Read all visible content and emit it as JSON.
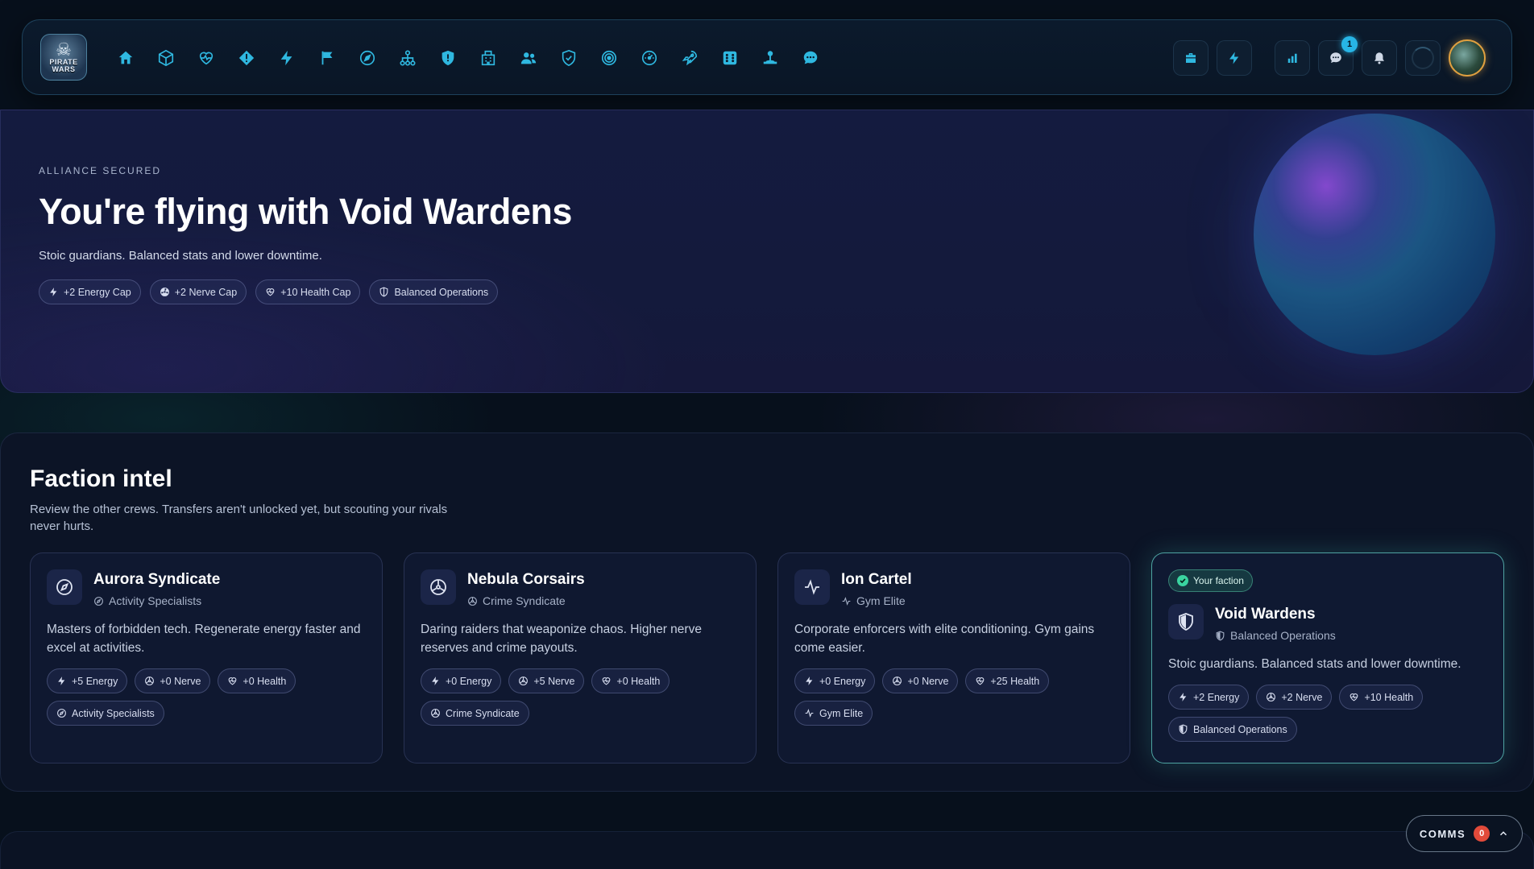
{
  "nav": {
    "logo_text": "PIRATE WARS",
    "items": [
      {
        "name": "home",
        "icon": "home-icon"
      },
      {
        "name": "inventory",
        "icon": "cube-icon"
      },
      {
        "name": "hospital",
        "icon": "heart-pulse-icon"
      },
      {
        "name": "crimes",
        "icon": "warning-diamond-icon"
      },
      {
        "name": "energy",
        "icon": "lightning-icon"
      },
      {
        "name": "missions",
        "icon": "flag-icon"
      },
      {
        "name": "explore",
        "icon": "compass-icon"
      },
      {
        "name": "network",
        "icon": "network-icon"
      },
      {
        "name": "defense",
        "icon": "shield-icon"
      },
      {
        "name": "city",
        "icon": "buildings-icon"
      },
      {
        "name": "crew",
        "icon": "users-icon"
      },
      {
        "name": "faction",
        "icon": "shield-check-icon"
      },
      {
        "name": "targets",
        "icon": "target-icon"
      },
      {
        "name": "dashboard",
        "icon": "gauge-icon"
      },
      {
        "name": "launch",
        "icon": "rocket-icon"
      },
      {
        "name": "casino",
        "icon": "dice-icon"
      },
      {
        "name": "arcade",
        "icon": "joystick-icon"
      },
      {
        "name": "chat",
        "icon": "chat-bubble-icon"
      }
    ],
    "tools": {
      "messages_badge": "1"
    },
    "accent": "#27b5e6"
  },
  "hero": {
    "eyebrow": "ALLIANCE SECURED",
    "title": "You're flying with Void Wardens",
    "subtitle": "Stoic guardians. Balanced stats and lower downtime.",
    "chips": [
      {
        "icon": "lightning-icon",
        "label": "+2 Energy Cap"
      },
      {
        "icon": "nerve-icon",
        "label": "+2 Nerve Cap"
      },
      {
        "icon": "heart-icon",
        "label": "+10 Health Cap"
      },
      {
        "icon": "shield-icon",
        "label": "Balanced Operations"
      }
    ]
  },
  "intel": {
    "title": "Faction intel",
    "subtitle": "Review the other crews. Transfers aren't unlocked yet, but scouting your rivals never hurts.",
    "your_faction_label": "Your faction",
    "cards": [
      {
        "name": "Aurora Syndicate",
        "type": "Activity Specialists",
        "icon": "compass-icon",
        "description": "Masters of forbidden tech. Regenerate energy faster and excel at activities.",
        "chips": [
          "+5 Energy",
          "+0 Nerve",
          "+0 Health",
          "Activity Specialists"
        ],
        "mine": false
      },
      {
        "name": "Nebula Corsairs",
        "type": "Crime Syndicate",
        "icon": "nerve-icon",
        "description": "Daring raiders that weaponize chaos. Higher nerve reserves and crime payouts.",
        "chips": [
          "+0 Energy",
          "+5 Nerve",
          "+0 Health",
          "Crime Syndicate"
        ],
        "mine": false
      },
      {
        "name": "Ion Cartel",
        "type": "Gym Elite",
        "icon": "activity-icon",
        "description": "Corporate enforcers with elite conditioning. Gym gains come easier.",
        "chips": [
          "+0 Energy",
          "+0 Nerve",
          "+25 Health",
          "Gym Elite"
        ],
        "mine": false
      },
      {
        "name": "Void Wardens",
        "type": "Balanced Operations",
        "icon": "shield-icon",
        "description": "Stoic guardians. Balanced stats and lower downtime.",
        "chips": [
          "+2 Energy",
          "+2 Nerve",
          "+10 Health",
          "Balanced Operations"
        ],
        "mine": true
      }
    ]
  },
  "comms": {
    "label": "COMMS",
    "count": "0"
  }
}
